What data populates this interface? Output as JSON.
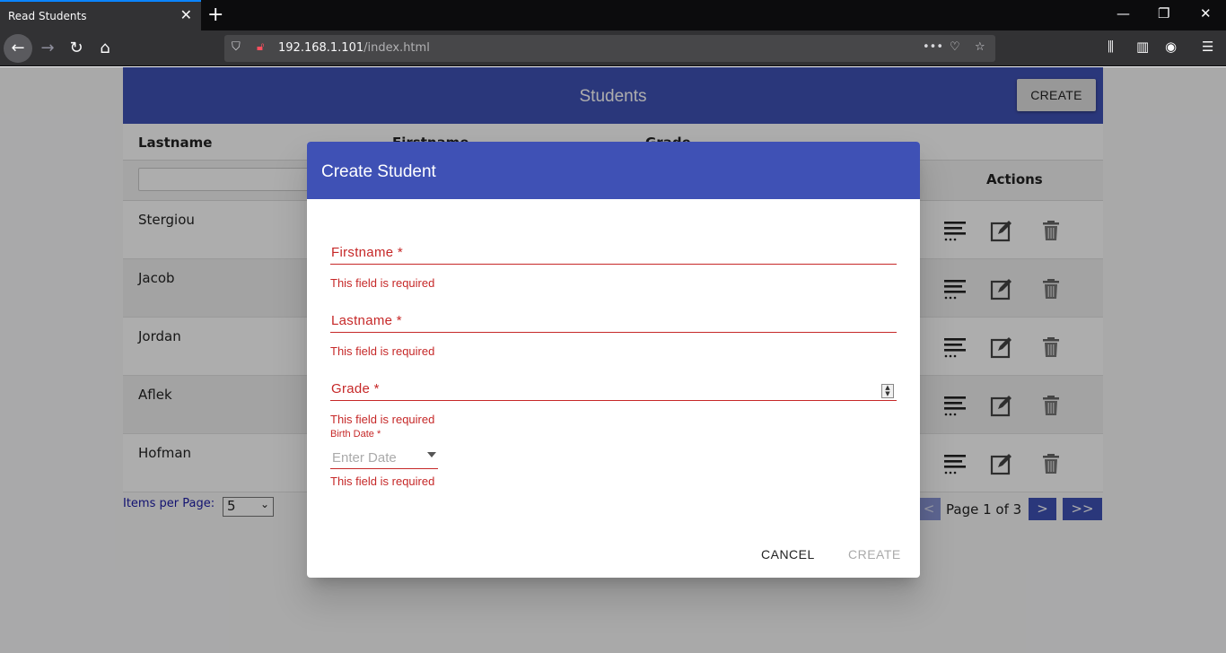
{
  "browser": {
    "tab_title": "Read Students",
    "url_host": "192.168.1.101",
    "url_path": "/index.html"
  },
  "header": {
    "title": "Students",
    "create_label": "CREATE"
  },
  "table": {
    "columns": [
      "Lastname",
      "Firstname",
      "Grade"
    ],
    "actions_label": "Actions",
    "rows": [
      {
        "lastname": "Stergiou"
      },
      {
        "lastname": "Jacob"
      },
      {
        "lastname": "Jordan"
      },
      {
        "lastname": "Aflek"
      },
      {
        "lastname": "Hofman"
      }
    ]
  },
  "pagination": {
    "items_per_page_label": "Items per Page:",
    "items_per_page_value": "5",
    "prev_label": "<",
    "page_info": "Page 1 of 3",
    "next_label": ">",
    "last_label": ">>"
  },
  "dialog": {
    "title": "Create Student",
    "fields": [
      {
        "label": "Firstname *",
        "error": "This field is required"
      },
      {
        "label": "Lastname *",
        "error": "This field is required"
      },
      {
        "label": "Grade *",
        "error": "This field is required"
      }
    ],
    "birth_date": {
      "label": "Birth Date *",
      "placeholder": "Enter Date",
      "error": "This field is required"
    },
    "cancel_label": "CANCEL",
    "create_label": "CREATE"
  }
}
